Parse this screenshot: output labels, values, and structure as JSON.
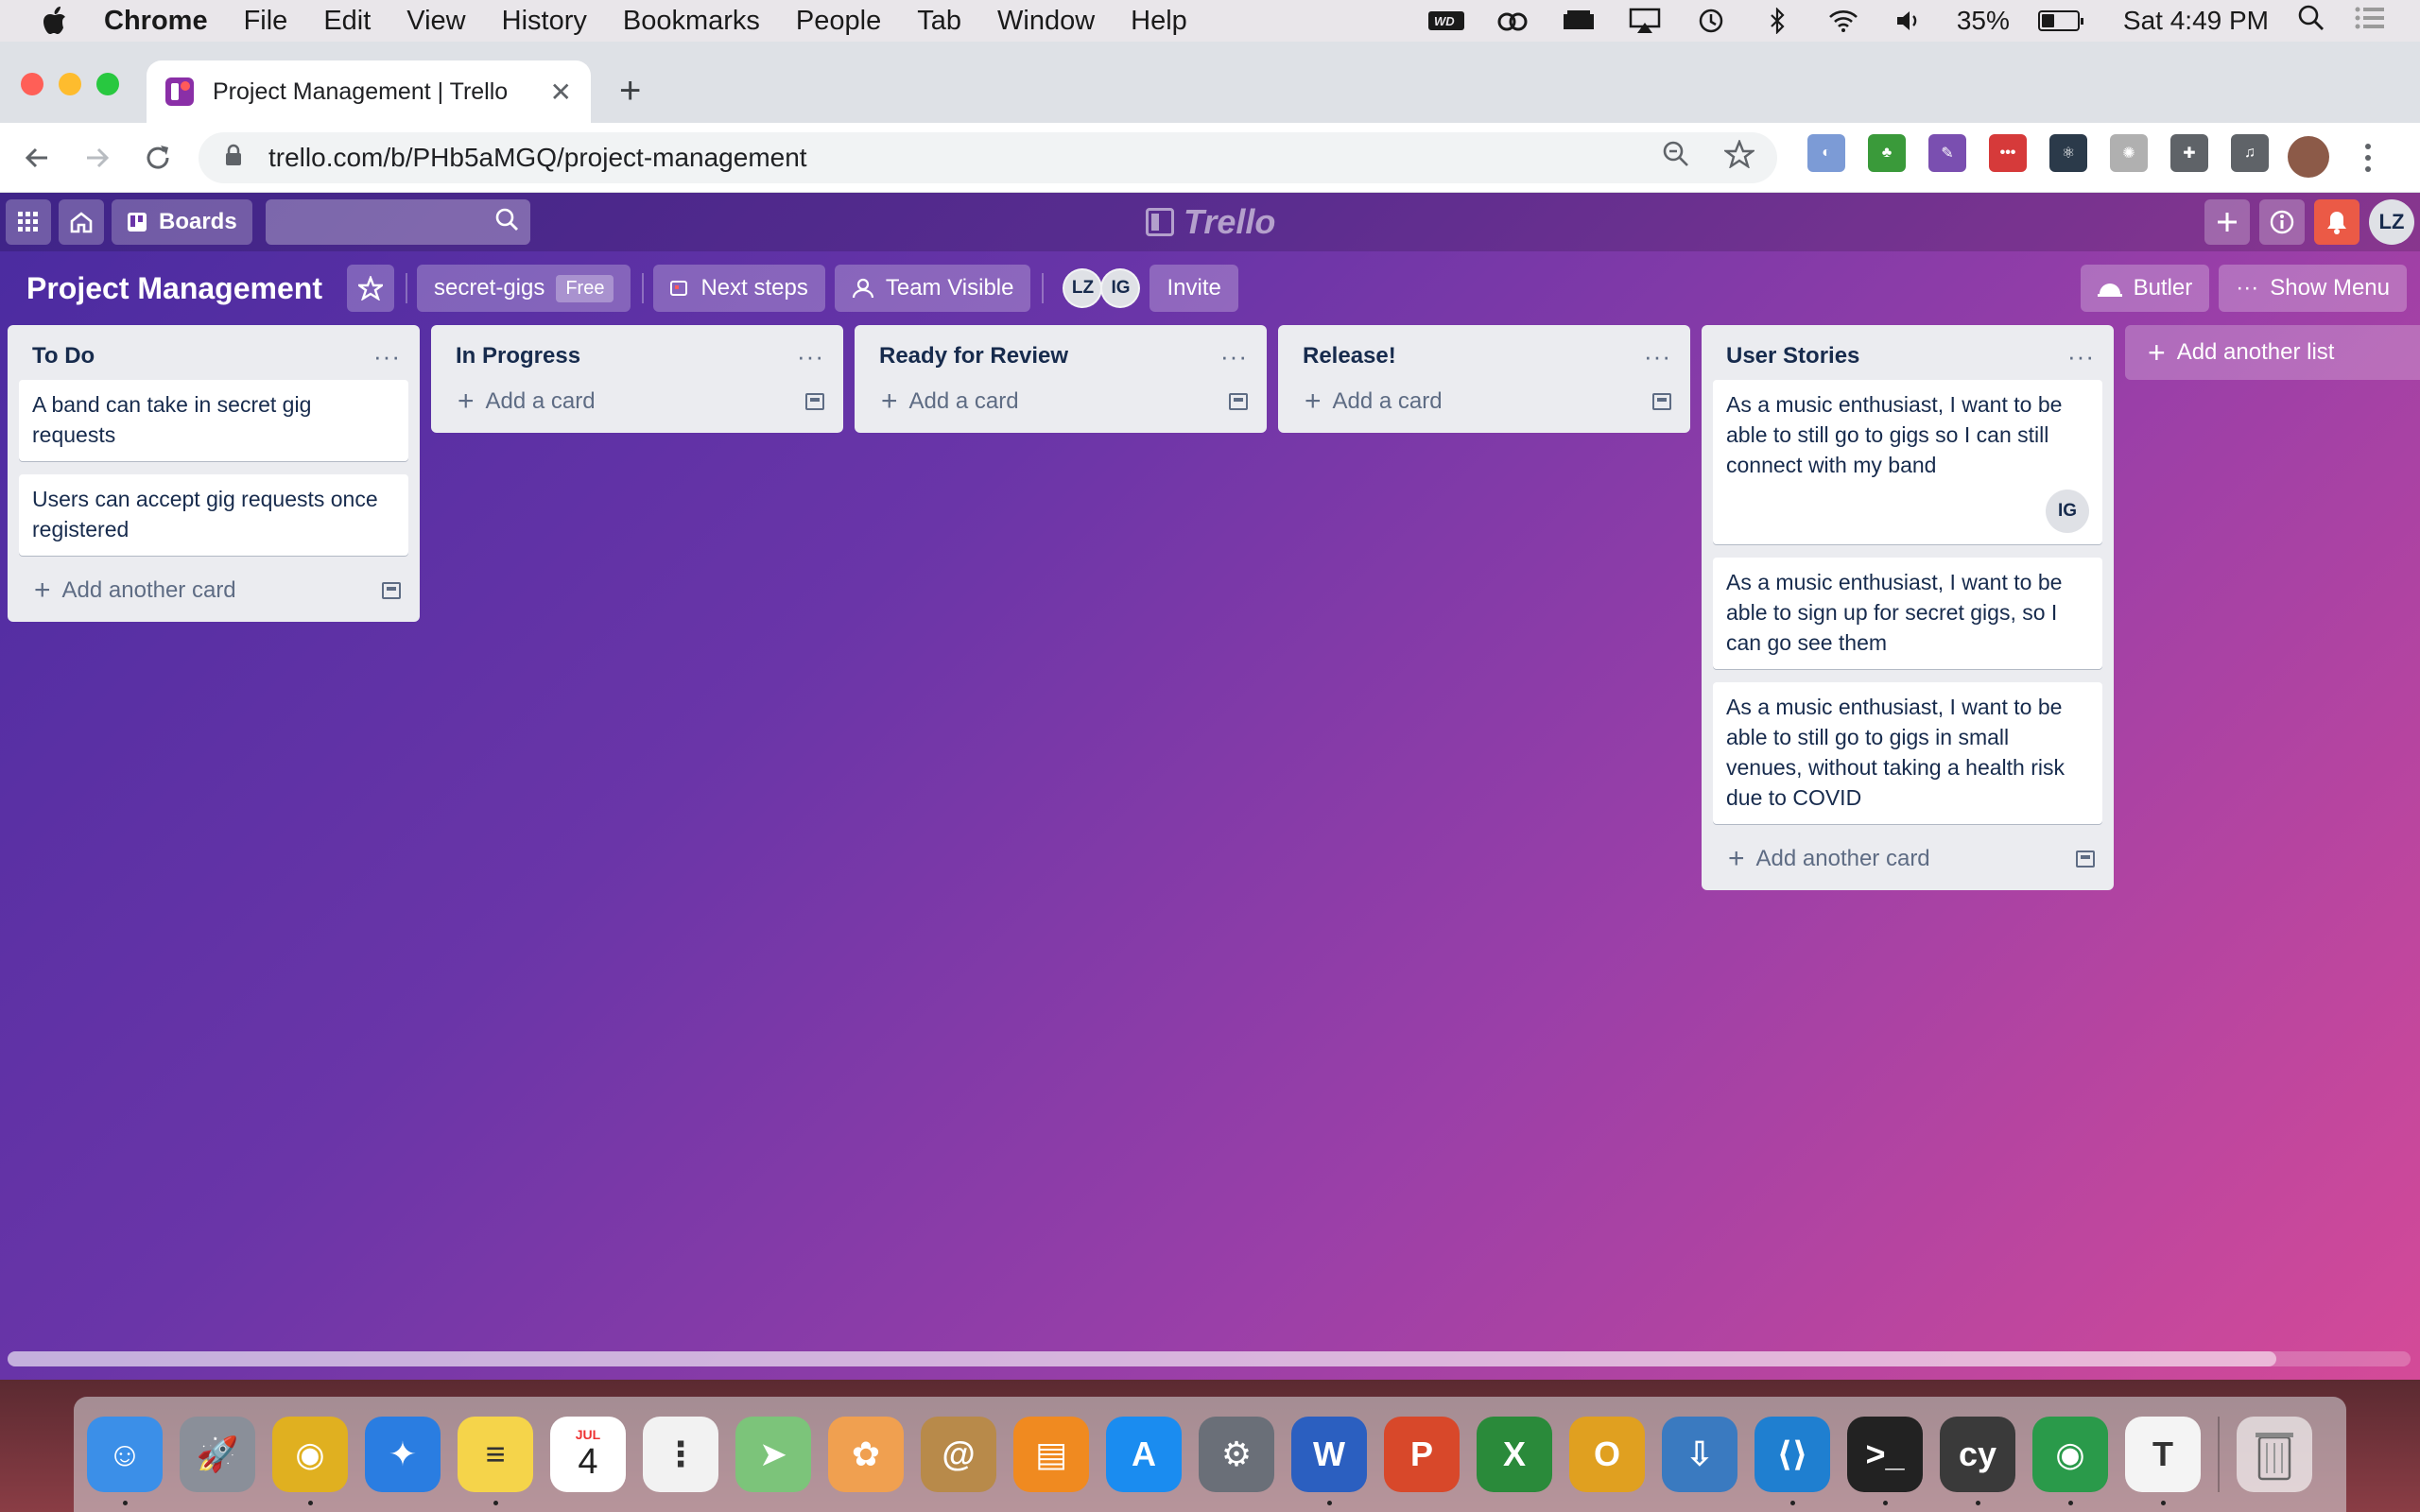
{
  "menubar": {
    "app_name": "Chrome",
    "items": [
      "File",
      "Edit",
      "View",
      "History",
      "Bookmarks",
      "People",
      "Tab",
      "Window",
      "Help"
    ],
    "battery_percent": "35%",
    "battery_level": 0.35,
    "clock": "Sat 4:49 PM",
    "status_icons": [
      "wd-icon",
      "creative-cloud-icon",
      "bartender-icon",
      "airplay-icon",
      "time-machine-icon",
      "bluetooth-icon",
      "wifi-icon",
      "volume-icon"
    ]
  },
  "browser": {
    "tab_title": "Project Management | Trello",
    "url": "trello.com/b/PHb5aMGQ/project-management",
    "extensions": [
      {
        "name": "ext-blue-icon",
        "color": "#7c9bd6",
        "glyph": "◐"
      },
      {
        "name": "html-tree-icon",
        "color": "#3a9a3a",
        "glyph": "♣"
      },
      {
        "name": "ext-purple-icon",
        "color": "#7a4fb0",
        "glyph": "✎"
      },
      {
        "name": "ext-red-icon",
        "color": "#d63a3a",
        "glyph": "•••"
      },
      {
        "name": "react-devtools-icon",
        "color": "#2b3a4a",
        "glyph": "⚛"
      },
      {
        "name": "ext-gray-icon",
        "color": "#b0b0b0",
        "glyph": "✺"
      },
      {
        "name": "puzzle-icon",
        "color": "#5f6368",
        "glyph": "✚"
      },
      {
        "name": "media-icon",
        "color": "#5f6368",
        "glyph": "♫"
      }
    ]
  },
  "trello": {
    "header": {
      "boards_label": "Boards",
      "logo_text": "Trello",
      "user_initials": "LZ"
    },
    "board": {
      "title": "Project Management",
      "team_name": "secret-gigs",
      "team_badge": "Free",
      "next_steps_label": "Next steps",
      "visibility_label": "Team Visible",
      "members": [
        "LZ",
        "IG"
      ],
      "invite_label": "Invite",
      "butler_label": "Butler",
      "show_menu_label": "Show Menu"
    },
    "lists": [
      {
        "title": "To Do",
        "cards": [
          {
            "text": "A band can take in secret gig requests"
          },
          {
            "text": "Users can accept gig requests once registered"
          }
        ],
        "add_label": "Add another card"
      },
      {
        "title": "In Progress",
        "cards": [],
        "add_label": "Add a card"
      },
      {
        "title": "Ready for Review",
        "cards": [],
        "add_label": "Add a card"
      },
      {
        "title": "Release!",
        "cards": [],
        "add_label": "Add a card"
      },
      {
        "title": "User Stories",
        "cards": [
          {
            "text": "As a music enthusiast, I want to be able to still go to gigs so I can still connect with my band",
            "member": "IG"
          },
          {
            "text": "As a music enthusiast, I want to be able to sign up for secret gigs, so I can go see them"
          },
          {
            "text": "As a music enthusiast, I want to be able to still go to gigs in small venues, without taking a health risk due to COVID"
          }
        ],
        "add_label": "Add another card"
      }
    ],
    "add_list_label": "Add another list"
  },
  "dock": {
    "calendar_month": "JUL",
    "calendar_day": "4",
    "apps": [
      {
        "name": "finder-icon",
        "color": "#3b8fe8",
        "glyph": "☺",
        "running": true
      },
      {
        "name": "launchpad-icon",
        "color": "#8a8f99",
        "glyph": "🚀",
        "running": false
      },
      {
        "name": "chrome-icon",
        "color": "#e0b020",
        "glyph": "◉",
        "running": true
      },
      {
        "name": "safari-icon",
        "color": "#2a7de1",
        "glyph": "✦",
        "running": false
      },
      {
        "name": "notes-icon",
        "color": "#f5d44a",
        "glyph": "≡",
        "running": true
      },
      {
        "name": "calendar-icon",
        "color": "#ffffff",
        "glyph": "",
        "running": false
      },
      {
        "name": "reminders-icon",
        "color": "#f2f2f2",
        "glyph": "⋮",
        "running": false
      },
      {
        "name": "maps-icon",
        "color": "#7cc47a",
        "glyph": "➤",
        "running": false
      },
      {
        "name": "photos-icon",
        "color": "#f0a050",
        "glyph": "✿",
        "running": false
      },
      {
        "name": "contacts-icon",
        "color": "#b88a4a",
        "glyph": "@",
        "running": false
      },
      {
        "name": "books-icon",
        "color": "#f08a20",
        "glyph": "▤",
        "running": false
      },
      {
        "name": "app-store-icon",
        "color": "#1a8cf0",
        "glyph": "A",
        "running": false
      },
      {
        "name": "system-preferences-icon",
        "color": "#6a6f78",
        "glyph": "⚙",
        "running": false
      },
      {
        "name": "word-icon",
        "color": "#2b5fc0",
        "glyph": "W",
        "running": true
      },
      {
        "name": "powerpoint-icon",
        "color": "#d8482a",
        "glyph": "P",
        "running": false
      },
      {
        "name": "excel-icon",
        "color": "#2a8a3a",
        "glyph": "X",
        "running": false
      },
      {
        "name": "outlook-icon",
        "color": "#e0a020",
        "glyph": "O",
        "running": false
      },
      {
        "name": "downloader-icon",
        "color": "#3a7ac0",
        "glyph": "⇩",
        "running": false
      },
      {
        "name": "vscode-icon",
        "color": "#1f7fd0",
        "glyph": "⟨⟩",
        "running": true
      },
      {
        "name": "terminal-icon",
        "color": "#222222",
        "glyph": ">_",
        "running": true
      },
      {
        "name": "cypress-icon",
        "color": "#3a3a3a",
        "glyph": "cy",
        "running": true
      },
      {
        "name": "chrome-2-icon",
        "color": "#2a9a4a",
        "glyph": "◉",
        "running": true
      },
      {
        "name": "typora-icon",
        "color": "#f4f4f4",
        "glyph": "T",
        "running": true
      }
    ],
    "trash_name": "trash-icon"
  }
}
